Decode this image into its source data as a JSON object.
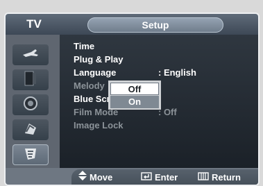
{
  "header": {
    "tv_label": "TV",
    "title": "Setup"
  },
  "sidebar": {
    "items": [
      {
        "icon": "antenna-icon"
      },
      {
        "icon": "picture-icon"
      },
      {
        "icon": "speaker-icon"
      },
      {
        "icon": "channel-icon"
      },
      {
        "icon": "setup-icon"
      }
    ],
    "active_index": 4
  },
  "menu": {
    "items": [
      {
        "label": "Time",
        "value": "",
        "enabled": true
      },
      {
        "label": "Plug & Play",
        "value": "",
        "enabled": true
      },
      {
        "label": "Language",
        "value": ": English",
        "enabled": true
      },
      {
        "label": "Melody",
        "value": ":",
        "enabled": false
      },
      {
        "label": "Blue Screen",
        "value": ":",
        "enabled": true
      },
      {
        "label": "Film Mode",
        "value": ": Off",
        "enabled": false
      },
      {
        "label": "Image Lock",
        "value": "",
        "enabled": false
      }
    ]
  },
  "dropdown": {
    "options": [
      "Off",
      "On"
    ],
    "selected": "Off"
  },
  "footer": {
    "move_label": "Move",
    "enter_label": "Enter",
    "return_label": "Return"
  },
  "colors": {
    "panel_bg": "#1b2128",
    "sidebar_bg": "#5f6670",
    "enabled_text": "#ffffff",
    "disabled_text": "#8c9399"
  }
}
